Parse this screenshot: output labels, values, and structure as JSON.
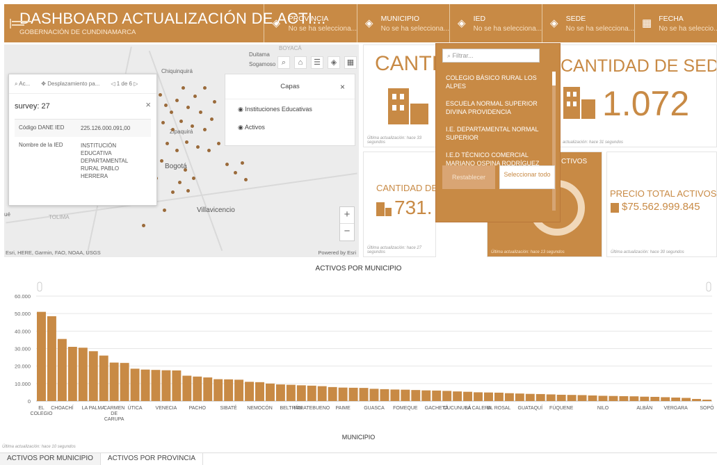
{
  "header": {
    "title": "DASHBOARD ACTUALIZACIÓN DE ACTI...",
    "subtitle": "GOBERNACIÓN DE CUNDINAMARCA",
    "filters": [
      {
        "label": "PROVINCIA",
        "value": "No se ha selecciona..."
      },
      {
        "label": "MUNICIPIO",
        "value": "No se ha selecciona..."
      },
      {
        "label": "IED",
        "value": "No se ha selecciona..."
      },
      {
        "label": "SEDE",
        "value": "No se ha selecciona..."
      },
      {
        "label": "FECHA",
        "value": "No se ha seleccio..."
      }
    ]
  },
  "map": {
    "places": {
      "duitama": "Duitama",
      "boyaca": "BOYACÁ",
      "sogamoso": "Sogamoso",
      "chiquinquira": "Chiquinquirá",
      "zipaquira": "Zipaquirá",
      "bogota": "Bogotá",
      "villavicencio": "Villavicencio",
      "tolima": "TOLIMA",
      "ibague": "ué"
    },
    "attribution": "Esri, HERE, Garmin, FAO, NOAA, USGS",
    "powered": "Powered by Esri",
    "layers_panel": {
      "title": "Capas",
      "items": [
        "Instituciones Educativas",
        "Activos"
      ]
    },
    "popup": {
      "toolbar_zoom": "Ac...",
      "toolbar_pan": "Desplazamiento pa...",
      "pager": "1 de 6",
      "title": "survey: 27",
      "rows": [
        {
          "key": "Código DANE IED",
          "value": "225.126.000.091,00"
        },
        {
          "key": "Nombre de la IED",
          "value": "INSTITUCIÓN EDUCATIVA DEPARTAMENTAL RURAL PABLO HERRERA"
        }
      ]
    }
  },
  "cards": {
    "ied_title": "CANTI",
    "ied_footer": "Última actualización: hace 33 segundos",
    "sedes_title": "CANTIDAD DE SEDES",
    "sedes_value": "1.072",
    "sedes_footer": "actualización: hace 31 segundos",
    "activos_title": "CANTIDAD DE",
    "activos_value": "731.",
    "activos_footer": "Última actualización: hace 27 segundos",
    "gauge_title": "CTIVOS",
    "gauge_footer": "Última actualización: hace 13 segundos",
    "precio_title": "PRECIO TOTAL ACTIVOS",
    "precio_value": "$75.562.999.845",
    "precio_footer": "Última actualización: hace 30 segundos"
  },
  "dropdown": {
    "placeholder": "Filtrar...",
    "items": [
      "COLEGIO BÁSICO RURAL LOS ALPES",
      "ESCUELA NORMAL SUPERIOR DIVINA PROVIDENCIA",
      "I.E. DEPARTAMENTAL NORMAL SUPERIOR",
      "I.E.D TÉCNICO COMERCIAL MARIANO OSPINA RODRÍGUEZ"
    ],
    "reset_label": "Restablecer",
    "select_all_label": "Seleccionar todo"
  },
  "chart_data": {
    "type": "bar",
    "title": "ACTIVOS POR MUNICIPIO",
    "xlabel": "MUNICIPIO",
    "ylabel": "",
    "ylim": [
      0,
      60000
    ],
    "yticks": [
      "0",
      "10.000",
      "20.000",
      "30.000",
      "40.000",
      "50.000",
      "60.000"
    ],
    "color": "#c88a45",
    "categories": [
      "EL COLEGIO",
      "",
      "CHOACHÍ",
      "",
      "",
      "LA PALMA",
      "",
      "CARMEN DE CARUPA",
      "",
      "ÚTICA",
      "",
      "",
      "VENECIA",
      "",
      "",
      "PACHO",
      "",
      "",
      "SIBATÉ",
      "",
      "",
      "NEMOCÓN",
      "",
      "",
      "BELTRÁN",
      "",
      "PARATEBUENO",
      "",
      "",
      "PAIME",
      "",
      "",
      "GUASCA",
      "",
      "",
      "FOMEQUE",
      "",
      "",
      "GACHETÁ",
      "",
      "CUCUNUBÁ",
      "",
      "LA CALERA",
      "",
      "EL ROSAL",
      "",
      "",
      "GUATAQUÍ",
      "",
      "",
      "FÚQUENE",
      "",
      "",
      "",
      "NILO",
      "",
      "",
      "",
      "ALBÁN",
      "",
      "",
      "VERGARA",
      "",
      "",
      "SOPÓ"
    ],
    "values": [
      51000,
      48500,
      35500,
      31000,
      30500,
      28500,
      26000,
      22000,
      21800,
      18500,
      18000,
      17800,
      17600,
      17500,
      14500,
      14000,
      13500,
      12500,
      12400,
      12200,
      11000,
      10800,
      10000,
      9500,
      9300,
      9000,
      8800,
      8500,
      8000,
      7700,
      7600,
      7500,
      7000,
      6800,
      6600,
      6500,
      6300,
      6100,
      6000,
      5800,
      5500,
      5300,
      5000,
      4900,
      4800,
      4500,
      4300,
      4100,
      4000,
      3800,
      3600,
      3500,
      3400,
      3200,
      3000,
      2900,
      2800,
      2700,
      2500,
      2400,
      2200,
      2000,
      1800,
      1200,
      800
    ]
  },
  "footer": {
    "note": "Última actualización: hace 10 segundos",
    "tabs": [
      "ACTIVOS POR MUNICIPIO",
      "ACTIVOS POR PROVINCIA"
    ]
  }
}
